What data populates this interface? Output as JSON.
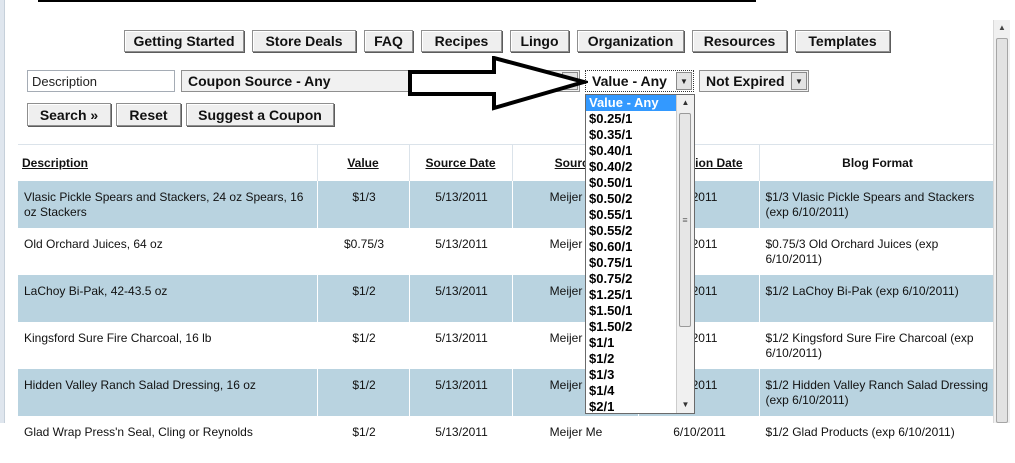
{
  "nav": {
    "items": [
      "Getting Started",
      "Store Deals",
      "FAQ",
      "Recipes",
      "Lingo",
      "Organization",
      "Resources",
      "Templates"
    ]
  },
  "filters": {
    "description_value": "Description",
    "coupon_source": "Coupon Source - Any",
    "value": "Value - Any",
    "expired": "Not Expired"
  },
  "actions": {
    "search": "Search »",
    "reset": "Reset",
    "suggest": "Suggest a Coupon"
  },
  "table": {
    "headers": [
      "Description",
      "Value",
      "Source Date",
      "Source",
      "Expiration Date",
      "Blog Format"
    ],
    "rows": [
      {
        "description": "Vlasic Pickle Spears and Stackers, 24 oz Spears, 16 oz Stackers",
        "value": "$1/3",
        "source_date": "5/13/2011",
        "source": "Meijer Me",
        "exp": "0/2011",
        "blog": "$1/3 Vlasic Pickle Spears and Stackers (exp 6/10/2011)"
      },
      {
        "description": "Old Orchard Juices, 64 oz",
        "value": "$0.75/3",
        "source_date": "5/13/2011",
        "source": "Meijer Me",
        "exp": "0/2011",
        "blog": "$0.75/3 Old Orchard Juices (exp 6/10/2011)"
      },
      {
        "description": "LaChoy Bi-Pak, 42-43.5 oz",
        "value": "$1/2",
        "source_date": "5/13/2011",
        "source": "Meijer Me",
        "exp": "0/2011",
        "blog": "$1/2 LaChoy Bi-Pak (exp 6/10/2011)"
      },
      {
        "description": "Kingsford Sure Fire Charcoal, 16 lb",
        "value": "$1/2",
        "source_date": "5/13/2011",
        "source": "Meijer Me",
        "exp": "0/2011",
        "blog": "$1/2 Kingsford Sure Fire Charcoal (exp 6/10/2011)"
      },
      {
        "description": "Hidden Valley Ranch Salad Dressing, 16 oz",
        "value": "$1/2",
        "source_date": "5/13/2011",
        "source": "Meijer Me",
        "exp": "0/2011",
        "blog": "$1/2 Hidden Valley Ranch Salad Dressing (exp 6/10/2011)"
      },
      {
        "description": "Glad Wrap Press'n Seal, Cling or Reynolds",
        "value": "$1/2",
        "source_date": "5/13/2011",
        "source": "Meijer Me",
        "exp": "6/10/2011",
        "blog": "$1/2 Glad Products (exp 6/10/2011)"
      }
    ]
  },
  "value_dropdown": {
    "options": [
      "Value - Any",
      "$0.25/1",
      "$0.35/1",
      "$0.40/1",
      "$0.40/2",
      "$0.50/1",
      "$0.50/2",
      "$0.55/1",
      "$0.55/2",
      "$0.60/1",
      "$0.75/1",
      "$0.75/2",
      "$1.25/1",
      "$1.50/1",
      "$1.50/2",
      "$1/1",
      "$1/2",
      "$1/3",
      "$1/4",
      "$2/1"
    ],
    "selected": "Value - Any",
    "highlight_color": "#3399ff"
  },
  "colors": {
    "row_alt": "#b9d3e0"
  }
}
